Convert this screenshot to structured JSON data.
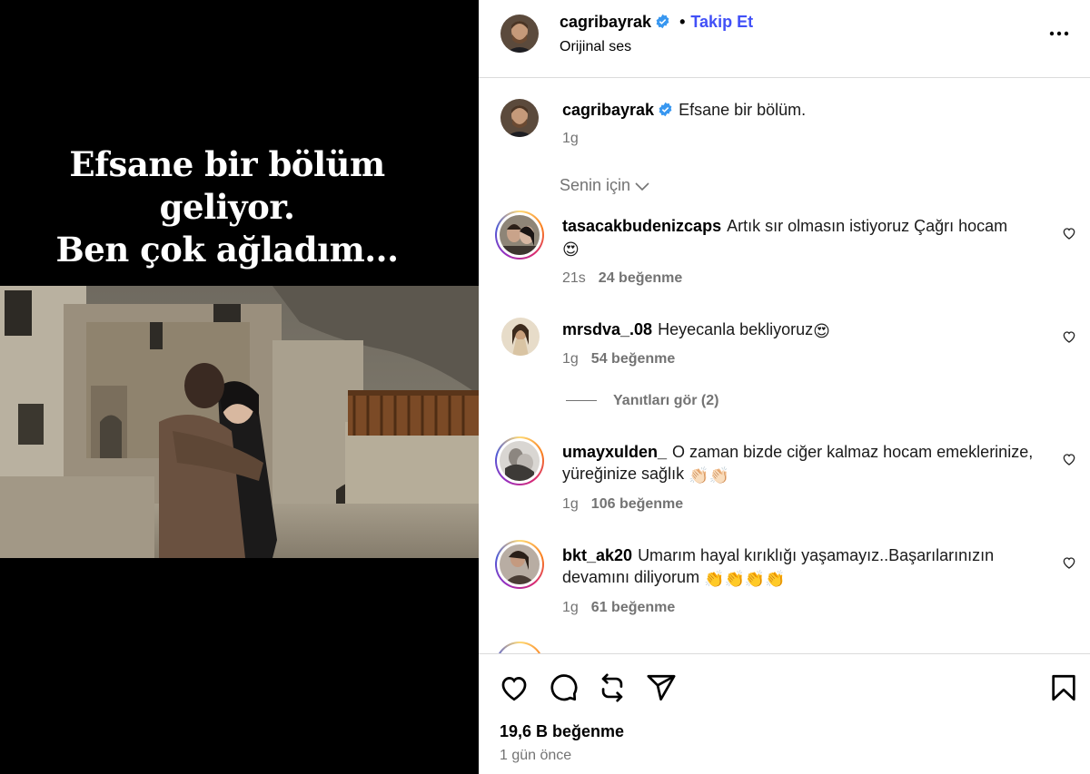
{
  "media": {
    "overlay_lines": [
      "Efsane bir bölüm",
      "geliyor.",
      "Ben çok ağladım..."
    ]
  },
  "header": {
    "username": "cagribayrak",
    "separator": "•",
    "follow_label": "Takip Et",
    "audio_label": "Orijinal ses"
  },
  "caption": {
    "username": "cagribayrak",
    "text": "Efsane bir bölüm.",
    "time": "1g"
  },
  "filter_label": "Senin için",
  "comments": [
    {
      "username": "tasacakbudenizcaps",
      "text": "Artık sır olmasın istiyoruz Çağrı hocam",
      "emoji": "😍",
      "time": "21s",
      "likes": "24 beğenme"
    },
    {
      "username": "mrsdva_.08",
      "text": "Heyecanla bekliyoruz",
      "emoji": "😍",
      "time": "1g",
      "likes": "54 beğenme"
    },
    {
      "username": "umayxulden_",
      "text": "O zaman bizde ciğer kalmaz hocam emeklerinize, yüreğinize sağlık",
      "emoji": "👏🏻👏🏻",
      "time": "1g",
      "likes": "106 beğenme"
    },
    {
      "username": "bkt_ak20",
      "text": "Umarım hayal kırıklığı yaşamayız..Başarılarınızın devamını diliyorum",
      "emoji": "👏👏👏👏",
      "time": "1g",
      "likes": "61 beğenme"
    }
  ],
  "view_replies": "Yanıtları gör (2)",
  "footer": {
    "likes_total": "19,6 B beğenme",
    "time_ago": "1 gün önce"
  },
  "colors": {
    "accent": "#4150f7",
    "verified": "#3897f0",
    "muted": "#737373",
    "border": "#dbdbdb"
  }
}
